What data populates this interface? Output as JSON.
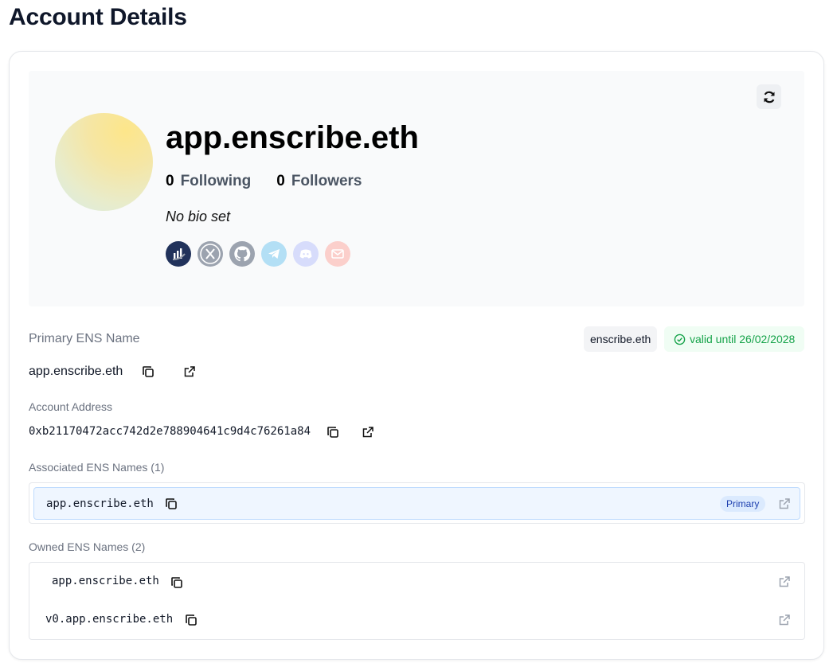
{
  "page": {
    "title": "Account Details"
  },
  "profile": {
    "name": "app.enscribe.eth",
    "following_count": "0",
    "following_label": "Following",
    "followers_count": "0",
    "followers_label": "Followers",
    "bio": "No bio set",
    "socials": [
      "etherscan-icon",
      "x-icon",
      "github-icon",
      "telegram-icon",
      "discord-icon",
      "email-icon"
    ]
  },
  "primary_ens": {
    "label": "Primary ENS Name",
    "value": "app.enscribe.eth",
    "parent_tag": "enscribe.eth",
    "valid_until": "valid until 26/02/2028"
  },
  "account_address": {
    "label": "Account Address",
    "value": "0xb21170472acc742d2e788904641c9d4c76261a84"
  },
  "associated": {
    "label": "Associated ENS Names (1)",
    "items": [
      {
        "name": "app.enscribe.eth",
        "badge": "Primary"
      }
    ]
  },
  "owned": {
    "label": "Owned ENS Names (2)",
    "items": [
      {
        "name": "app.enscribe.eth"
      },
      {
        "name": "v0.app.enscribe.eth"
      }
    ]
  },
  "colors": {
    "valid_green": "#16a34a",
    "primary_badge_bg": "#dbeafe",
    "primary_badge_text": "#1e40af"
  }
}
